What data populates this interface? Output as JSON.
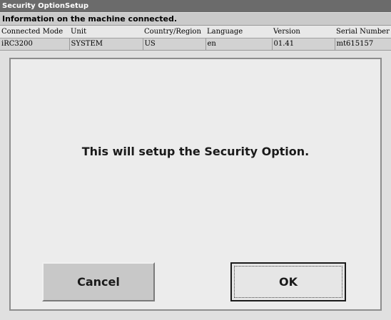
{
  "window": {
    "title": "Security OptionSetup"
  },
  "info": {
    "header": "Information on the machine connected.",
    "columns": [
      "Connected Mode",
      "Unit",
      "Country/Region",
      "Language",
      "Version",
      "Serial Number"
    ],
    "values": [
      "iRC3200",
      "SYSTEM",
      "US",
      "en",
      "01.41",
      "mt615157"
    ]
  },
  "dialog": {
    "message": "This will setup the Security Option.",
    "cancel_label": "Cancel",
    "ok_label": "OK"
  },
  "colors": {
    "title_bar": "#6b6b6b",
    "background": "#e0e0e0",
    "panel": "#ececec"
  }
}
